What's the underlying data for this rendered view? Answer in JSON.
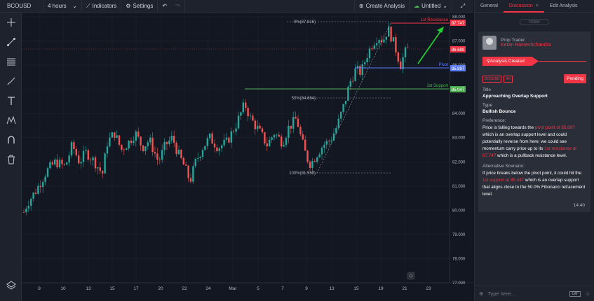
{
  "toolbar": {
    "symbol": "BCOUSD",
    "interval": "4 hours",
    "indicators": "Indicators",
    "settings": "Settings",
    "create_analysis": "Create Analysis",
    "untitled": "Untitled"
  },
  "chart": {
    "y_ticks": [
      "88.000",
      "87.000",
      "86.000",
      "85.000",
      "84.000",
      "83.000",
      "82.000",
      "81.000",
      "80.000",
      "79.000",
      "78.000",
      "77.000"
    ],
    "x_ticks": [
      "8",
      "10",
      "13",
      "15",
      "17",
      "20",
      "22",
      "24",
      "Mar",
      "5",
      "7",
      "9",
      "13",
      "15",
      "19",
      "21",
      "23"
    ],
    "fib_top": "0%(87.816)",
    "fib_mid": "50%(84.684)",
    "fib_bottom": "100%(81.553)",
    "resistance_label": "1st Resistance",
    "resistance_value": "87.747",
    "pivot_label": "Pivot",
    "pivot_value": "85.897",
    "support_label": "1st Support",
    "support_value": "85.047",
    "last_price": "86.689",
    "colors": {
      "up": "#26a69a",
      "down": "#ef5350",
      "resistance": "#f23645",
      "pivot": "#5b7cfa",
      "support": "#4caf50",
      "arrow": "#22d430"
    }
  },
  "panel": {
    "tabs": [
      "General",
      "Discussion",
      "Edit Analysis"
    ],
    "today": "TODAY",
    "author_role": "Prop Trader",
    "author_name": "Ketan Rameshchandra",
    "created": "Analysis Created",
    "badge_symbol": "BCOUSD",
    "badge_interval": "4H",
    "status": "Pending",
    "title_label": "Title",
    "title_value": "Approaching Overlap Support",
    "type_label": "Type",
    "type_value": "Bullish Bounce",
    "pref_label": "Preference:",
    "pref_1": "Price is falling towards the ",
    "pref_hl1": "pivot point of 85.897",
    "pref_2": " which is an overlap support level and could potentially reverse from here; we could see momentum carry price up to its ",
    "pref_hl2": "1st resistance at 87.747",
    "pref_3": " which is a pullback resistance level.",
    "alt_label": "Alternative Scenario:",
    "alt_1": "If price breaks below the pivot point, it could hit the ",
    "alt_hl": "1st support at 85.047",
    "alt_2": " which is an overlap support that aligns close to the 50.0% Fibonacci retracement level.",
    "time": "14:40",
    "input_placeholder": "Type here...",
    "gif": "GIF"
  }
}
